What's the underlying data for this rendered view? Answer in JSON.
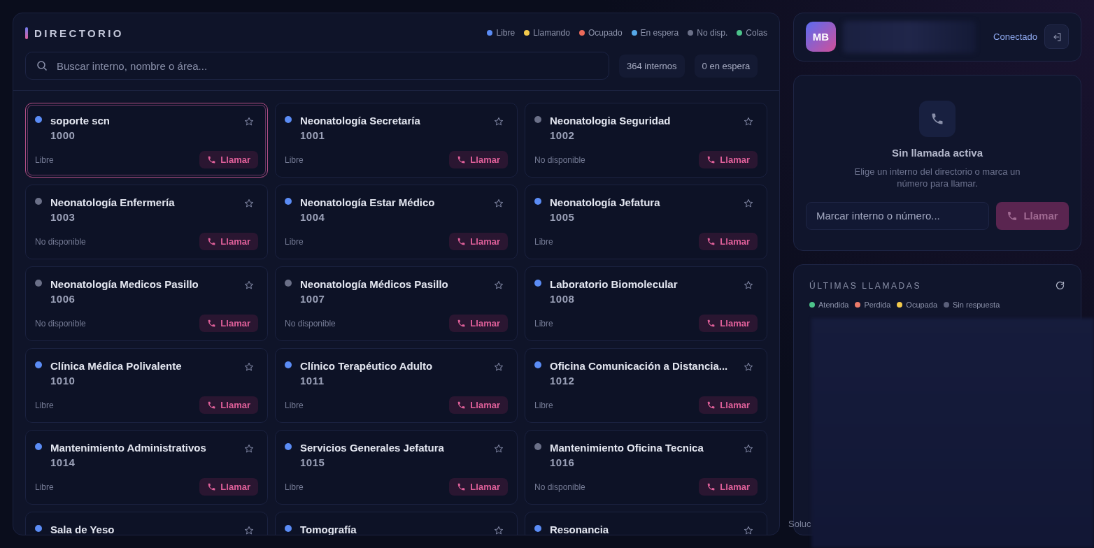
{
  "directory": {
    "title": "DIRECTORIO",
    "legend": [
      {
        "label": "Libre",
        "color": "#5b8cf5"
      },
      {
        "label": "Llamando",
        "color": "#f2c94c"
      },
      {
        "label": "Ocupado",
        "color": "#eb6a5a"
      },
      {
        "label": "En espera",
        "color": "#56a8e8"
      },
      {
        "label": "No disp.",
        "color": "#6b7088"
      },
      {
        "label": "Colas",
        "color": "#4cc38a"
      }
    ],
    "search": {
      "placeholder": "Buscar interno, nombre o área..."
    },
    "counts": [
      "364 internos",
      "0 en espera"
    ],
    "extensions": [
      {
        "name": "soporte scn",
        "number": "1000",
        "status": "Libre",
        "color": "#5b8cf5",
        "selected": true,
        "call": "Llamar"
      },
      {
        "name": "Neonatología Secretaría",
        "number": "1001",
        "status": "Libre",
        "color": "#5b8cf5",
        "selected": false,
        "call": "Llamar"
      },
      {
        "name": "Neonatologia Seguridad",
        "number": "1002",
        "status": "No disponible",
        "color": "#6b7088",
        "selected": false,
        "call": "Llamar"
      },
      {
        "name": "Neonatología Enfermería",
        "number": "1003",
        "status": "No disponible",
        "color": "#6b7088",
        "selected": false,
        "call": "Llamar"
      },
      {
        "name": "Neonatología Estar Médico",
        "number": "1004",
        "status": "Libre",
        "color": "#5b8cf5",
        "selected": false,
        "call": "Llamar"
      },
      {
        "name": "Neonatología Jefatura",
        "number": "1005",
        "status": "Libre",
        "color": "#5b8cf5",
        "selected": false,
        "call": "Llamar"
      },
      {
        "name": "Neonatología Medicos Pasillo",
        "number": "1006",
        "status": "No disponible",
        "color": "#6b7088",
        "selected": false,
        "call": "Llamar"
      },
      {
        "name": "Neonatología Médicos Pasillo",
        "number": "1007",
        "status": "No disponible",
        "color": "#6b7088",
        "selected": false,
        "call": "Llamar"
      },
      {
        "name": "Laboratorio Biomolecular",
        "number": "1008",
        "status": "Libre",
        "color": "#5b8cf5",
        "selected": false,
        "call": "Llamar"
      },
      {
        "name": "Clínica Médica Polivalente",
        "number": "1010",
        "status": "Libre",
        "color": "#5b8cf5",
        "selected": false,
        "call": "Llamar"
      },
      {
        "name": "Clínico Terapéutico Adulto",
        "number": "1011",
        "status": "Libre",
        "color": "#5b8cf5",
        "selected": false,
        "call": "Llamar"
      },
      {
        "name": "Oficina Comunicación a Distancia...",
        "number": "1012",
        "status": "Libre",
        "color": "#5b8cf5",
        "selected": false,
        "call": "Llamar"
      },
      {
        "name": "Mantenimiento Administrativos",
        "number": "1014",
        "status": "Libre",
        "color": "#5b8cf5",
        "selected": false,
        "call": "Llamar"
      },
      {
        "name": "Servicios Generales Jefatura",
        "number": "1015",
        "status": "Libre",
        "color": "#5b8cf5",
        "selected": false,
        "call": "Llamar"
      },
      {
        "name": "Mantenimiento Oficina Tecnica",
        "number": "1016",
        "status": "No disponible",
        "color": "#6b7088",
        "selected": false,
        "call": "Llamar"
      },
      {
        "name": "Sala de Yeso",
        "color": "#5b8cf5",
        "selected": false
      },
      {
        "name": "Tomografía",
        "color": "#5b8cf5",
        "selected": false
      },
      {
        "name": "Resonancia",
        "color": "#5b8cf5",
        "selected": false
      }
    ]
  },
  "profile": {
    "initials": "MB",
    "connection": "Conectado"
  },
  "call_panel": {
    "title": "Sin llamada activa",
    "hint": "Elige un interno del directorio o marca un número para llamar.",
    "dial": {
      "placeholder": "Marcar interno o número..."
    },
    "call_button": {
      "label": "Llamar",
      "disabled": true
    }
  },
  "recent_calls": {
    "title": "ÚLTIMAS LLAMADAS",
    "legend": [
      {
        "label": "Atendida",
        "color": "#4cc38a"
      },
      {
        "label": "Perdida",
        "color": "#eb7a6a"
      },
      {
        "label": "Ocupada",
        "color": "#f2c94c"
      },
      {
        "label": "Sin respuesta",
        "color": "#5a5f7a"
      }
    ]
  },
  "footer": {
    "text": "Soluc"
  }
}
